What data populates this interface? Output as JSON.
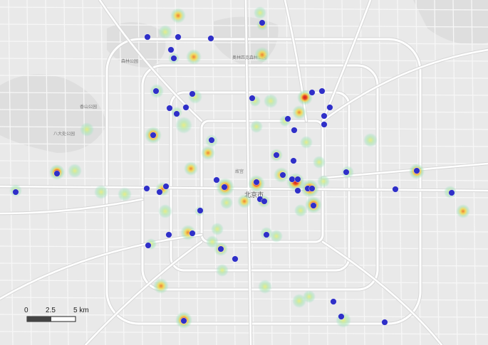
{
  "map": {
    "labels": [
      {
        "text": "北京市"
      },
      {
        "text": "香山公园"
      },
      {
        "text": "八大处公园"
      },
      {
        "text": "森林公园"
      },
      {
        "text": "奥林匹克森林公园"
      },
      {
        "text": "故宫"
      }
    ],
    "scalebar": {
      "ticks": [
        "0",
        "2.5",
        "5 km"
      ]
    },
    "colors": {
      "background": "#e9e9e9",
      "road_major": "#ffffff",
      "road_minor": "#f6f6f6",
      "road_outline": "#d4d4d4",
      "green_area": "#dcdcdc",
      "point": "#2f2fc8",
      "heat_low": "#a8e4b8",
      "heat_mid": "#f2e15a",
      "heat_high": "#d11a1a"
    }
  }
}
